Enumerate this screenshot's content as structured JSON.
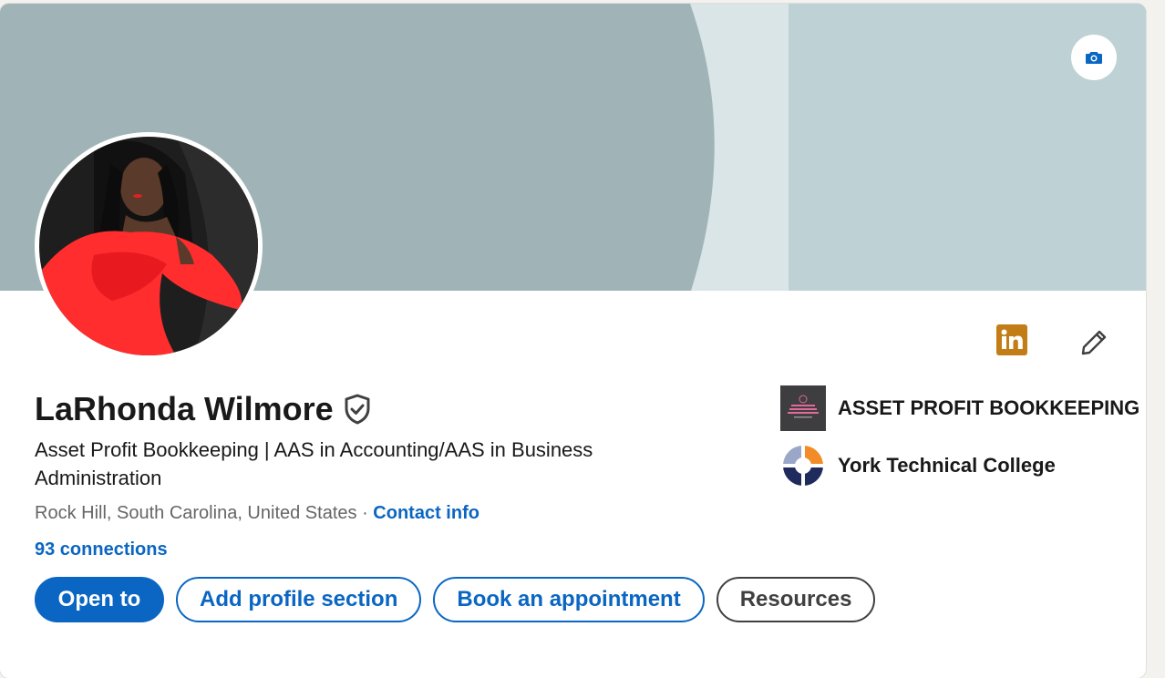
{
  "profile": {
    "name": "LaRhonda Wilmore",
    "headline": "Asset Profit Bookkeeping | AAS in Accounting/AAS in Business Administration",
    "location": "Rock Hill, South Carolina, United States",
    "separator": "·",
    "contact_info_label": "Contact info",
    "connections_label": "93 connections"
  },
  "actions": {
    "open_to": "Open to",
    "add_profile_section": "Add profile section",
    "book_appointment": "Book an appointment",
    "resources": "Resources"
  },
  "organizations": [
    {
      "name": "ASSET PROFIT BOOKKEEPING",
      "icon": "company-logo"
    },
    {
      "name": "York Technical College",
      "icon": "school-logo"
    }
  ],
  "icons": {
    "camera": "camera-icon",
    "linkedin": "linkedin-icon",
    "edit": "pencil-icon",
    "verified": "verified-shield-icon"
  },
  "colors": {
    "brand_blue": "#0a66c2",
    "banner": "#a0b4b7",
    "linkedin_badge": "#c37d16",
    "text_primary": "#191919",
    "text_secondary": "#666666"
  }
}
